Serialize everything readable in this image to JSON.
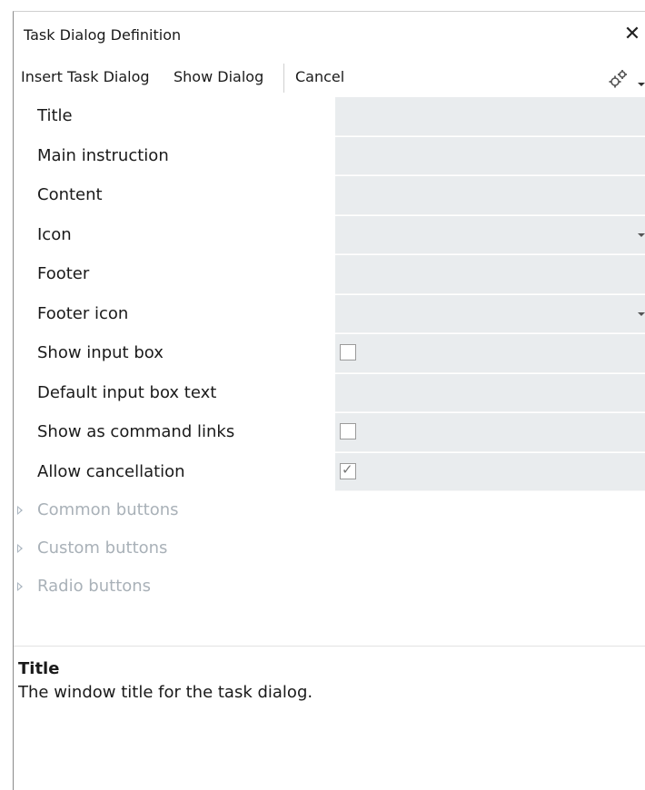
{
  "window": {
    "title": "Task Dialog Definition",
    "close_glyph": "✕"
  },
  "toolbar": {
    "insert_label": "Insert Task Dialog",
    "show_label": "Show Dialog",
    "cancel_label": "Cancel",
    "settings_icon": "gear-icon"
  },
  "properties": [
    {
      "label": "Title",
      "type": "text",
      "value": ""
    },
    {
      "label": "Main instruction",
      "type": "text",
      "value": ""
    },
    {
      "label": "Content",
      "type": "text",
      "value": ""
    },
    {
      "label": "Icon",
      "type": "dropdown",
      "value": ""
    },
    {
      "label": "Footer",
      "type": "text",
      "value": ""
    },
    {
      "label": "Footer icon",
      "type": "dropdown",
      "value": ""
    },
    {
      "label": "Show input box",
      "type": "checkbox",
      "checked": false
    },
    {
      "label": "Default input box text",
      "type": "text",
      "value": ""
    },
    {
      "label": "Show as command links",
      "type": "checkbox",
      "checked": false
    },
    {
      "label": "Allow cancellation",
      "type": "checkbox",
      "checked": true
    }
  ],
  "sections": [
    {
      "label": "Common buttons"
    },
    {
      "label": "Custom buttons"
    },
    {
      "label": "Radio buttons"
    }
  ],
  "description": {
    "title": "Title",
    "text": "The window title for the task dialog."
  },
  "colors": {
    "value_bg": "#e9ecee",
    "section_text": "#a9b1b8"
  }
}
